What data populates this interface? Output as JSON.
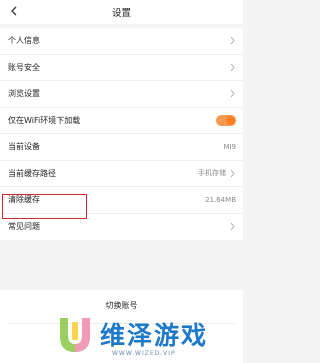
{
  "header": {
    "title": "设置"
  },
  "settings": {
    "items": [
      {
        "label": "个人信息",
        "value": ""
      },
      {
        "label": "账号安全",
        "value": ""
      },
      {
        "label": "浏览设置",
        "value": ""
      },
      {
        "label": "仅在WiFi环境下加载",
        "toggle_on": true
      },
      {
        "label": "当前设备",
        "value": "MI9"
      },
      {
        "label": "当前缓存路径",
        "value": "手机存储"
      },
      {
        "label": "清除缓存",
        "value": "21.64MB"
      },
      {
        "label": "常见问题",
        "value": ""
      }
    ]
  },
  "account": {
    "switch_label": "切换账号"
  },
  "watermark": {
    "text": "维泽游戏",
    "url": "WWW.WIZED.VIP"
  },
  "colors": {
    "accent": "#ff7f1e",
    "highlight": "#d8262c",
    "brand": "#1f79c9"
  }
}
